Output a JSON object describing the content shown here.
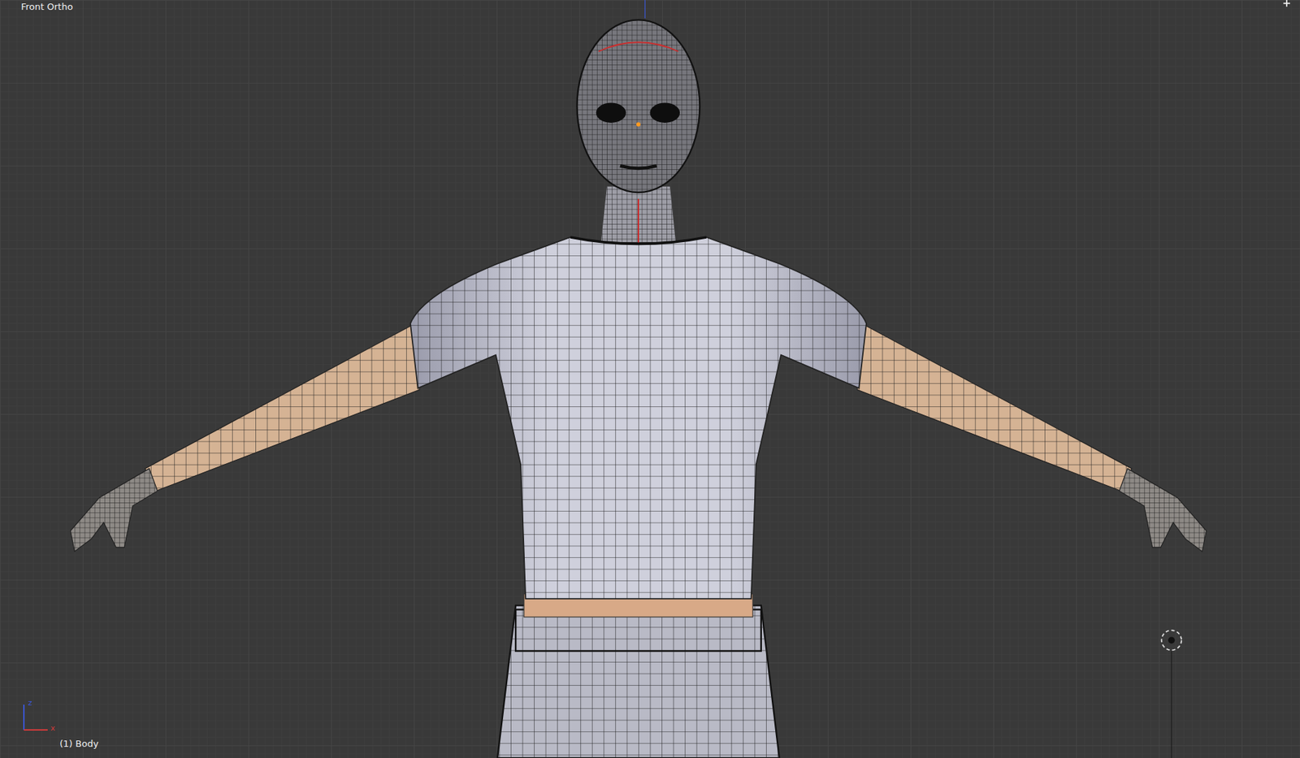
{
  "viewport": {
    "view_name": "Front Ortho",
    "object_label": "(1) Body"
  },
  "axes": [
    {
      "label": "x",
      "color": "#d03a3a"
    },
    {
      "label": "z",
      "color": "#3a55d0"
    }
  ]
}
